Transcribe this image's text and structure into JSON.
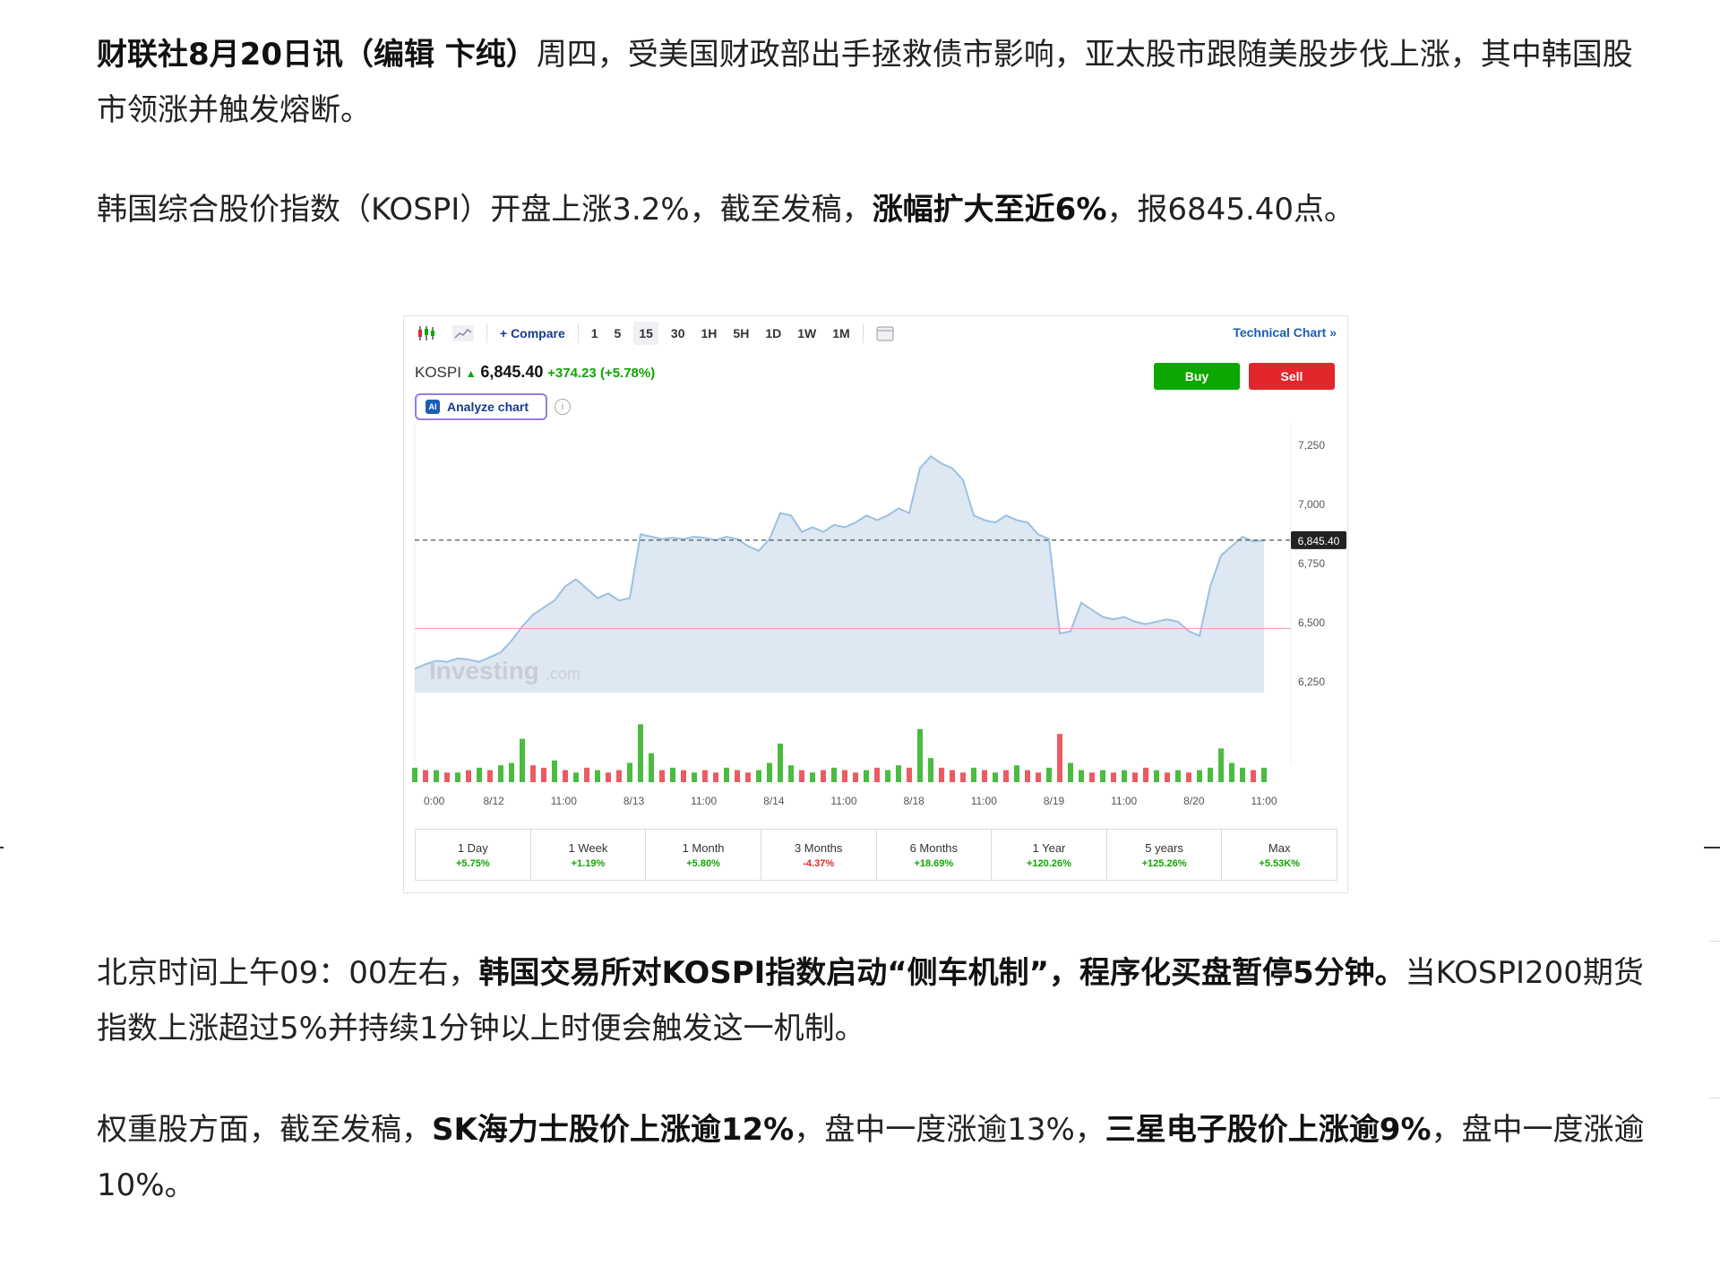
{
  "article": {
    "p1": {
      "bold_lead": "财联社8月20日讯（编辑 卞纯）",
      "text": "周四，受美国财政部出手拯救债市影响，亚太股市跟随美股步伐上涨，其中韩国股市领涨并触发熔断。"
    },
    "p2": {
      "text_a": "韩国综合股价指数（KOSPI）开盘上涨3.2%，截至发稿，",
      "bold": "涨幅扩大至近6%",
      "text_b": "，报6845.40点。"
    },
    "p3": {
      "text_a": "北京时间上午09：00左右，",
      "bold": "韩国交易所对KOSPI指数启动“侧车机制”，程序化买盘暂停5分钟。",
      "text_b": "当KOSPI200期货指数上涨超过5%并持续1分钟以上时便会触发这一机制。"
    },
    "p4": {
      "text_a": "权重股方面，截至发稿，",
      "bold_a": "SK海力士股价上涨逾12%",
      "text_b": "，盘中一度涨逾13%，",
      "bold_b": "三星电子股价上涨逾9%",
      "text_c": "，盘中一度涨逾10%。"
    }
  },
  "chart_widget": {
    "toolbar": {
      "compare": "+ Compare",
      "intervals": [
        "1",
        "5",
        "15",
        "30",
        "1H",
        "5H",
        "1D",
        "1W",
        "1M"
      ],
      "active_interval": "15",
      "technical_chart": "Technical Chart »"
    },
    "quote": {
      "symbol": "KOSPI",
      "price": "6,845.40",
      "change": "+374.23 (+5.78%)"
    },
    "buy_label": "Buy",
    "sell_label": "Sell",
    "analyze_label": "Analyze chart",
    "ai_badge": "AI",
    "watermark": "Investing",
    "watermark_suffix": ".com",
    "current_price_tag": "6,845.40",
    "periods": [
      {
        "label": "1 Day",
        "value": "+5.75%",
        "dir": "pos"
      },
      {
        "label": "1 Week",
        "value": "+1.19%",
        "dir": "pos"
      },
      {
        "label": "1 Month",
        "value": "+5.80%",
        "dir": "pos"
      },
      {
        "label": "3 Months",
        "value": "-4.37%",
        "dir": "neg"
      },
      {
        "label": "6 Months",
        "value": "+18.69%",
        "dir": "pos"
      },
      {
        "label": "1 Year",
        "value": "+120.26%",
        "dir": "pos"
      },
      {
        "label": "5 years",
        "value": "+125.26%",
        "dir": "pos"
      },
      {
        "label": "Max",
        "value": "+5.53K%",
        "dir": "pos"
      }
    ],
    "colors": {
      "up": "#0ea600",
      "down": "#e3262c",
      "area_fill": "#dde8f3",
      "line": "#9cc0e0"
    }
  },
  "chart_data": {
    "type": "area",
    "title": "",
    "xlabel": "",
    "ylabel": "",
    "ylim": [
      6200,
      7300
    ],
    "yticks": [
      "7,250",
      "7,000",
      "6,750",
      "6,500",
      "6,250"
    ],
    "ytick_values": [
      7250,
      7000,
      6750,
      6500,
      6250
    ],
    "xticks": [
      "0:00",
      "8/12",
      "11:00",
      "8/13",
      "11:00",
      "8/14",
      "11:00",
      "8/18",
      "11:00",
      "8/19",
      "11:00",
      "8/20",
      "11:00"
    ],
    "previous_close": 6471,
    "current_value": 6845.4,
    "series": [
      {
        "values": [
          6300,
          6320,
          6335,
          6330,
          6345,
          6340,
          6330,
          6350,
          6370,
          6420,
          6480,
          6530,
          6560,
          6590,
          6650,
          6680,
          6640,
          6600,
          6620,
          6590,
          6600,
          6870,
          6860,
          6850,
          6855,
          6850,
          6860,
          6855,
          6845,
          6860,
          6850,
          6820,
          6800,
          6850,
          6960,
          6950,
          6880,
          6900,
          6880,
          6910,
          6900,
          6920,
          6950,
          6930,
          6950,
          6980,
          6960,
          7150,
          7200,
          7170,
          7150,
          7100,
          6950,
          6930,
          6920,
          6950,
          6930,
          6920,
          6870,
          6850,
          6450,
          6460,
          6580,
          6550,
          6520,
          6510,
          6520,
          6500,
          6490,
          6500,
          6510,
          6500,
          6460,
          6440,
          6650,
          6780,
          6820,
          6860,
          6840,
          6845
        ]
      }
    ],
    "volume": [
      6,
      5,
      5,
      4,
      4,
      5,
      6,
      5,
      7,
      8,
      18,
      7,
      6,
      9,
      5,
      4,
      6,
      5,
      4,
      5,
      8,
      24,
      12,
      5,
      6,
      5,
      4,
      5,
      4,
      6,
      5,
      4,
      5,
      8,
      16,
      7,
      5,
      4,
      5,
      6,
      5,
      4,
      5,
      6,
      5,
      7,
      6,
      22,
      10,
      6,
      5,
      4,
      6,
      5,
      4,
      5,
      7,
      5,
      4,
      6,
      20,
      8,
      5,
      4,
      5,
      4,
      5,
      4,
      6,
      5,
      4,
      5,
      4,
      5,
      6,
      14,
      8,
      6,
      5,
      6
    ],
    "volume_down": [
      0,
      1,
      0,
      1,
      0,
      1,
      0,
      1,
      0,
      0,
      0,
      1,
      1,
      0,
      1,
      0,
      1,
      0,
      1,
      1,
      0,
      0,
      0,
      1,
      0,
      1,
      0,
      1,
      1,
      0,
      1,
      1,
      0,
      0,
      0,
      0,
      1,
      0,
      1,
      0,
      1,
      1,
      0,
      1,
      0,
      0,
      1,
      0,
      0,
      1,
      1,
      1,
      0,
      1,
      0,
      1,
      0,
      1,
      1,
      0,
      1,
      0,
      0,
      1,
      0,
      1,
      0,
      1,
      1,
      0,
      1,
      0,
      1,
      0,
      0,
      0,
      0,
      0,
      1,
      0
    ]
  }
}
